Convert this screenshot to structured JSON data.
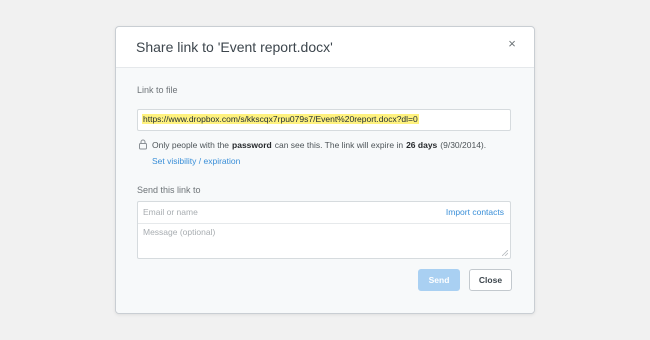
{
  "dialog": {
    "title": "Share link to 'Event report.docx'",
    "close_icon": "×"
  },
  "link_section": {
    "label": "Link to file",
    "url": "https://www.dropbox.com/s/kkscqx7rpu079s7/Event%20report.docx?dl=0",
    "note_prefix": "Only people with the",
    "note_bold1": "password",
    "note_middle": "can see this.  The link will expire in",
    "note_bold2": "26 days",
    "note_suffix": "(9/30/2014).",
    "visibility_link": "Set visibility / expiration"
  },
  "send_section": {
    "label": "Send this link to",
    "email_placeholder": "Email or name",
    "import_contacts": "Import contacts",
    "message_placeholder": "Message (optional)"
  },
  "buttons": {
    "send": "Send",
    "close": "Close"
  },
  "colors": {
    "highlight": "#fff27f",
    "link": "#3a8fd8",
    "send_button_disabled": "#a9d0f2"
  },
  "icons": {
    "lock": "lock-icon",
    "close": "close-icon"
  }
}
